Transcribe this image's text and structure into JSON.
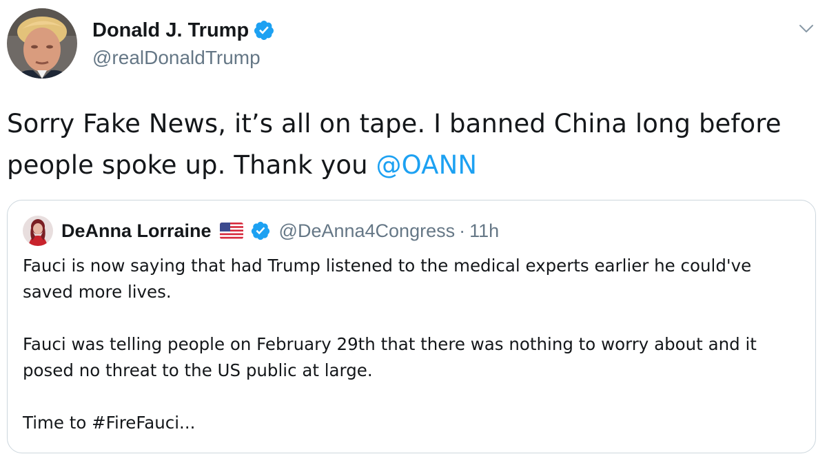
{
  "tweet": {
    "author": {
      "display_name": "Donald J. Trump",
      "handle": "@realDonaldTrump",
      "verified": true,
      "avatar_icon": "profile-photo"
    },
    "menu_icon": "chevron-down-icon",
    "text_before_mention": "Sorry Fake News, it’s all on tape. I banned China long before people spoke up. Thank you ",
    "mention": "@OANN",
    "accent_color": "#1da1f2",
    "quoted": {
      "author": {
        "display_name": "DeAnna Lorraine",
        "flag_icon": "us-flag-icon",
        "verified": true,
        "handle": "@DeAnna4Congress",
        "separator": "·",
        "time": "11h"
      },
      "paragraphs": [
        "Fauci is now saying that had Trump listened to the medical experts earlier he could've saved more lives.",
        "Fauci was telling people on February 29th that there was nothing to worry about and it posed no threat to the US public at large.",
        "Time to #FireFauci..."
      ]
    }
  }
}
